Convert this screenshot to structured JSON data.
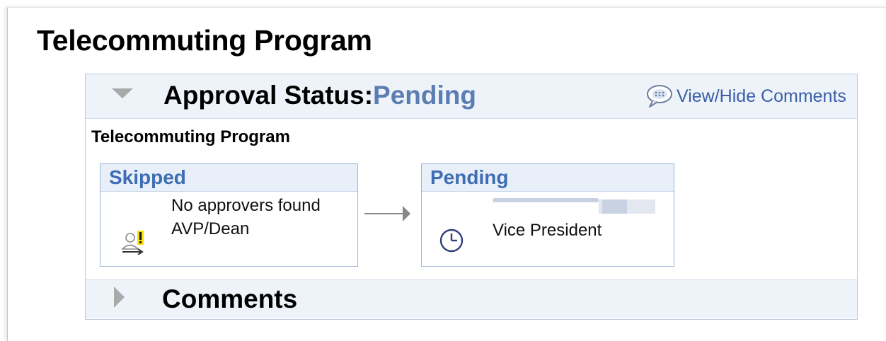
{
  "page": {
    "title": "Telecommuting Program"
  },
  "approval": {
    "status_label": "Approval Status:",
    "status_value": "Pending",
    "view_hide_comments": "View/Hide Comments",
    "section_title": "Telecommuting Program",
    "steps": [
      {
        "status": "Skipped",
        "line1": "No approvers found",
        "line2": "AVP/Dean",
        "icon": "user-warning-icon"
      },
      {
        "status": "Pending",
        "line1": "Vice President",
        "icon": "clock-icon"
      }
    ]
  },
  "comments": {
    "label": "Comments"
  },
  "colors": {
    "header_bg": "#eef3fa",
    "status_blue": "#5b7db3",
    "link_blue": "#3a5fa6",
    "step_header_text": "#3d6db3",
    "border_blue": "#9eb6d8"
  }
}
